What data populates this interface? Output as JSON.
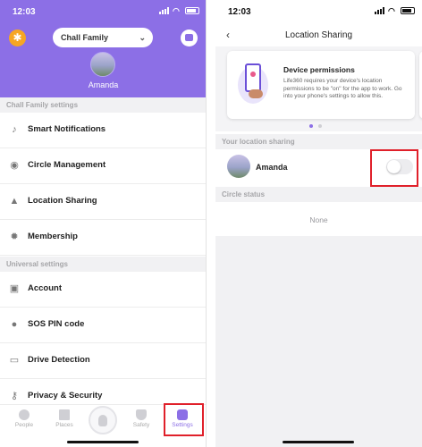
{
  "left": {
    "status_time": "12:03",
    "circle_name": "Chall Family",
    "user_name": "Amanda",
    "section_circle": "Chall Family settings",
    "circle_items": [
      {
        "label": "Smart Notifications",
        "icon": "bell-icon"
      },
      {
        "label": "Circle Management",
        "icon": "circle-icon"
      },
      {
        "label": "Location Sharing",
        "icon": "location-arrow-icon"
      },
      {
        "label": "Membership",
        "icon": "badge-icon"
      }
    ],
    "section_universal": "Universal settings",
    "universal_items": [
      {
        "label": "Account",
        "icon": "person-icon"
      },
      {
        "label": "SOS PIN code",
        "icon": "sos-icon"
      },
      {
        "label": "Drive Detection",
        "icon": "car-icon"
      },
      {
        "label": "Privacy & Security",
        "icon": "key-icon"
      }
    ],
    "tabs": [
      {
        "label": "People",
        "icon": "people-icon"
      },
      {
        "label": "Places",
        "icon": "places-icon"
      },
      {
        "label": "Safety",
        "icon": "shield-icon"
      },
      {
        "label": "Settings",
        "icon": "gear-icon"
      }
    ],
    "active_tab": "Settings"
  },
  "right": {
    "status_time": "12:03",
    "title": "Location Sharing",
    "card": {
      "title": "Device permissions",
      "body": "Life360 requires your device's location permissions to be \"on\" for the app to work. Go into your phone's settings to allow this."
    },
    "section_sharing": "Your location sharing",
    "member_name": "Amanda",
    "sharing_on": false,
    "section_circle_status": "Circle status",
    "circle_status_value": "None"
  },
  "colors": {
    "accent": "#8c6fe6",
    "highlight_box": "#e0202a",
    "gear_badge": "#f6a623"
  }
}
